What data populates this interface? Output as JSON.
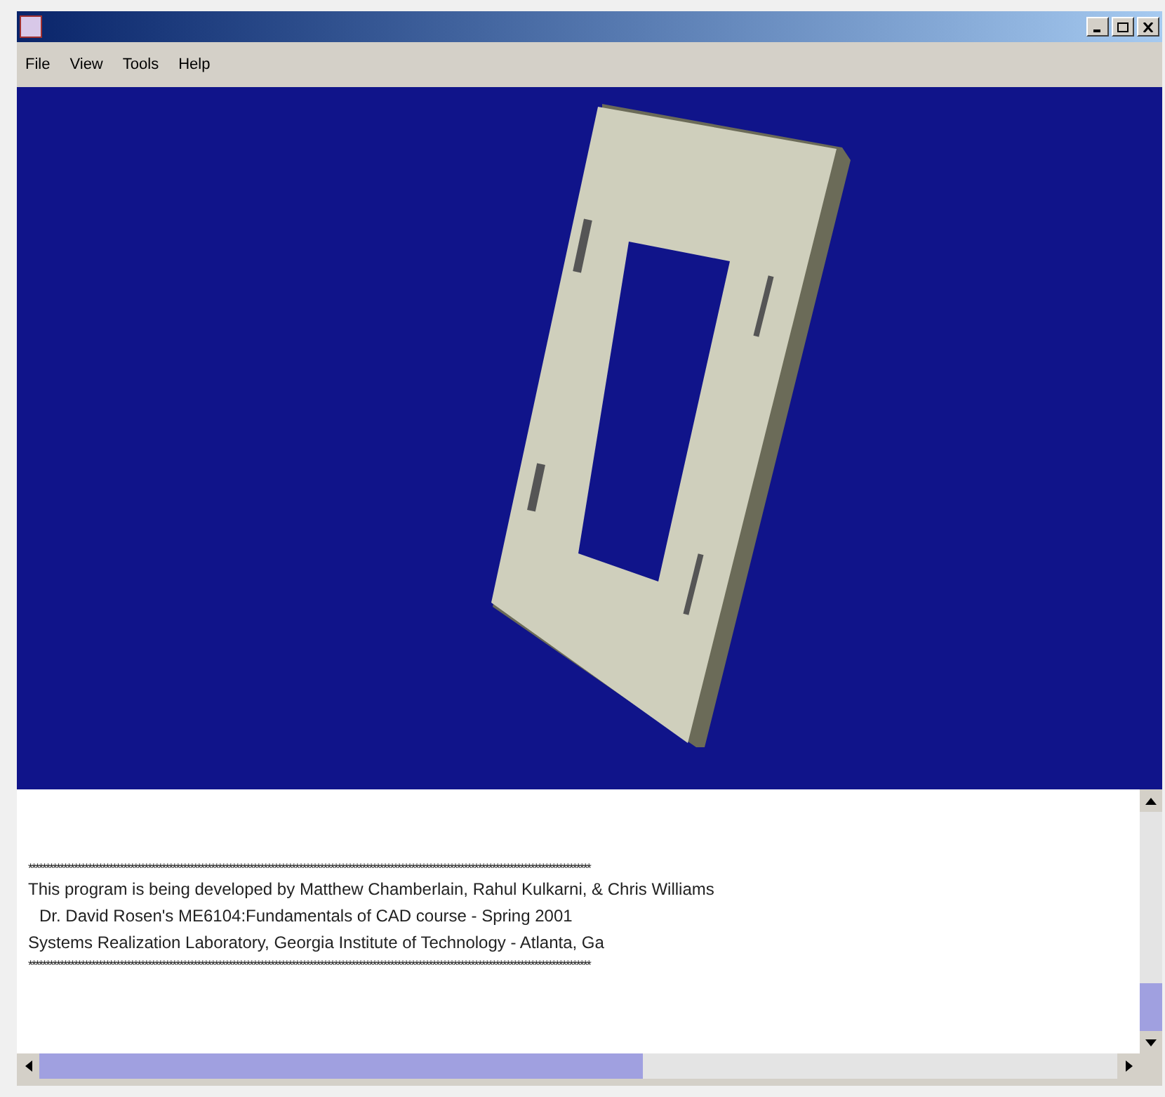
{
  "menu": [
    "File",
    "View",
    "Tools",
    "Help"
  ],
  "console": {
    "lines": [
      {
        "text": "****************************************************************************************************************************************************************",
        "indented": false
      },
      {
        "text": "This program is being developed by Matthew Chamberlain, Rahul Kulkarni, & Chris Williams",
        "indented": false
      },
      {
        "text": "Dr. David Rosen's ME6104:Fundamentals of CAD course - Spring 2001",
        "indented": true
      },
      {
        "text": "Systems Realization Laboratory, Georgia Institute of Technology - Atlanta, Ga",
        "indented": false
      },
      {
        "text": "****************************************************************************************************************************************************************",
        "indented": false
      }
    ]
  }
}
